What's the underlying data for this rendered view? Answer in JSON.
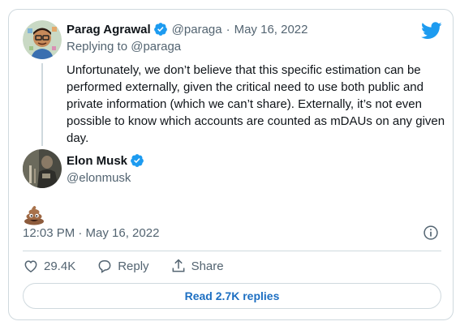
{
  "reply_tweet": {
    "display_name": "Parag Agrawal",
    "handle": "@paraga",
    "separator": "·",
    "date": "May 16, 2022",
    "replying_prefix": "Replying to",
    "replying_handle": "@paraga",
    "text": "Unfortunately, we don’t believe that this specific estimation can be performed externally, given the critical need to use both public and private information (which we can’t share). Externally, it’s not even possible to know which accounts are counted as mDAUs on any given day."
  },
  "main_tweet": {
    "display_name": "Elon Musk",
    "handle": "@elonmusk",
    "content_emoji": "💩",
    "timestamp": "12:03 PM · May 16, 2022"
  },
  "actions": {
    "like_count": "29.4K",
    "reply_label": "Reply",
    "share_label": "Share",
    "read_replies_label": "Read 2.7K replies"
  },
  "colors": {
    "twitter_blue": "#1d9bf0",
    "text_primary": "#0f1419",
    "text_secondary": "#536471",
    "border": "#cfd9de"
  },
  "icons": [
    "verified-icon",
    "twitter-bird-icon",
    "info-icon",
    "heart-icon",
    "reply-icon",
    "share-icon"
  ]
}
